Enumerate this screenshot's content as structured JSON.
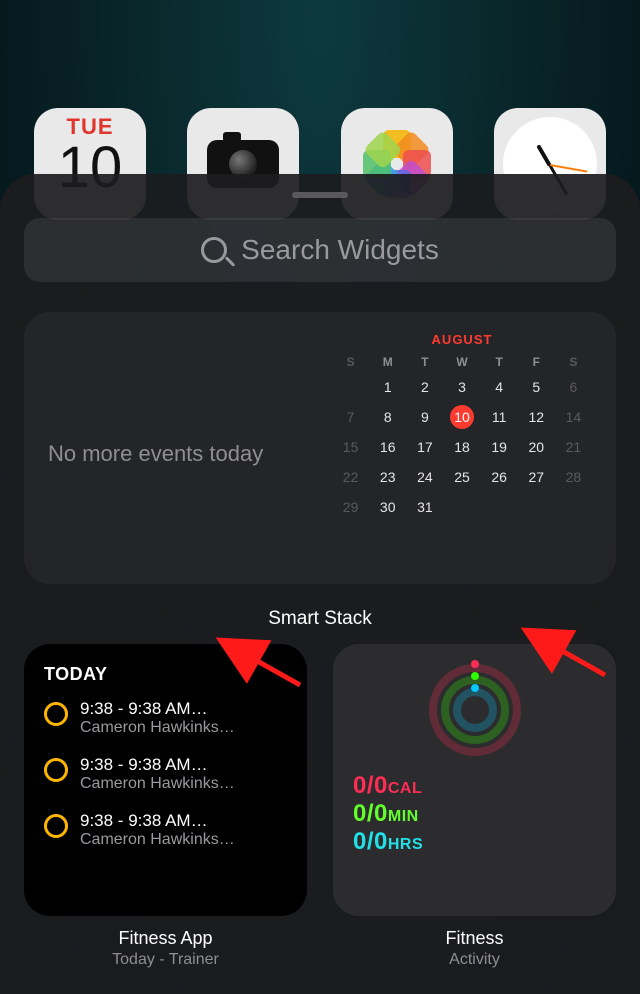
{
  "home_icons": {
    "calendar": {
      "dow": "TUE",
      "day": "10"
    }
  },
  "sheet": {
    "search_placeholder": "Search Widgets",
    "calendar_widget": {
      "left_text": "No more events today",
      "month": "AUGUST",
      "dows": [
        "S",
        "M",
        "T",
        "W",
        "T",
        "F",
        "S"
      ],
      "today": 10,
      "weeks": [
        [
          null,
          1,
          2,
          3,
          4,
          5,
          6
        ],
        [
          null,
          8,
          9,
          10,
          11,
          12,
          13
        ],
        [
          15,
          16,
          17,
          18,
          19,
          20,
          21
        ],
        [
          22,
          23,
          24,
          25,
          26,
          27,
          28
        ],
        [
          29,
          30,
          31,
          null,
          null,
          null,
          null
        ]
      ],
      "dim_days": [
        7,
        14,
        21,
        28
      ]
    },
    "smart_stack_label": "Smart Stack",
    "fitness_app_widget": {
      "title": "TODAY",
      "items": [
        {
          "time": "9:38 - 9:38 AM…",
          "name": "Cameron Hawkinks…"
        },
        {
          "time": "9:38 - 9:38 AM…",
          "name": "Cameron Hawkinks…"
        },
        {
          "time": "9:38 - 9:38 AM…",
          "name": "Cameron Hawkinks…"
        }
      ],
      "app_name": "Fitness App",
      "widget_name": "Today - Trainer"
    },
    "fitness_widget": {
      "stats": {
        "cal": "0/0",
        "cal_unit": "CAL",
        "min": "0/0",
        "min_unit": "MIN",
        "hrs": "0/0",
        "hrs_unit": "HRS"
      },
      "app_name": "Fitness",
      "widget_name": "Activity"
    },
    "page_dots": {
      "count": 7,
      "active": 0
    }
  }
}
